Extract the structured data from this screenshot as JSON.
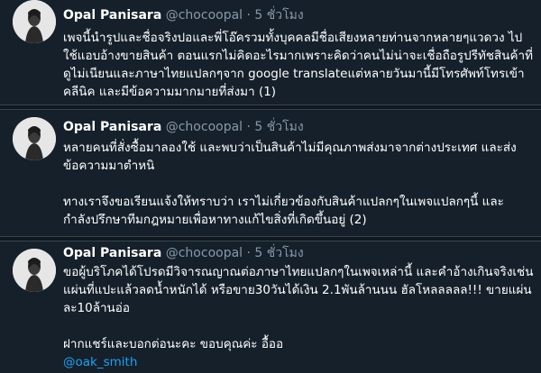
{
  "colors": {
    "background": "#15202b",
    "separator": "#10171e",
    "secondary_text": "#8899a6",
    "link": "#1da1f2"
  },
  "tweets": [
    {
      "name": "Opal Panisara",
      "handle": "@chocoopal",
      "separator": "·",
      "time": "5 ชั่วโมง",
      "lines": [
        "เพจนี้นำรูปและชื่อจริงปอและพี่โอ๊ครวมทั้งบุคคลมีชื่อเสียงหลายท่านจากหลายๆแวดวง ไป",
        "ใช้แอบอ้างขายสินค้า ตอนแรกไม่คิดอะไรมากเพราะคิดว่าคนไม่น่าจะเชื่อถือรูปรีทัชสินค้าที่",
        "ดูไม่เนียนและภาษาไทยแปลกๆจาก google translateแต่หลายวันมานี้มีโทรศัพท์โทรเข้า",
        "คลีนิค และมีข้อความมากมายที่ส่งมา (1)"
      ]
    },
    {
      "name": "Opal Panisara",
      "handle": "@chocoopal",
      "separator": "·",
      "time": "5 ชั่วโมง",
      "lines": [
        "หลายคนที่สั่งซื้อมาลองใช้ และพบว่าเป็นสินค้าไม่มีคุณภาพส่งมาจากต่างประเทศ และส่ง",
        "ข้อความมาตำหนิ",
        "",
        "ทางเราจึงขอเรียนแจ้งให้ทราบว่า เราไม่เกี่ยวข้องกับสินค้าแปลกๆในเพจแปลกๆนี้ และ",
        "กำลังปรึกษาทีมกฎหมายเพื่อหาทางแก้ไขสิ่งที่เกิดขึ้นอยู่ (2)"
      ]
    },
    {
      "name": "Opal Panisara",
      "handle": "@chocoopal",
      "separator": "·",
      "time": "5 ชั่วโมง",
      "lines": [
        "ขอผู้บริโภคได้โปรดมีวิจารณญาณต่อภาษาไทยแปลกๆในเพจเหล่านี้ และคำอ้างเกินจริงเช่น",
        "แผ่นที่แปะแล้วลดน้ำหนักได้ หรือขาย30วันได้เงิน 2.1พันล้านนน ฮัลโหลลลลล!!! ขายแผ่น",
        "ละ10ล้านอ่อ",
        "",
        "ฝากแชร์และบอกต่อนะคะ ขอบคุณค่ะ อื้ออ"
      ],
      "mention": "@oak_smith"
    }
  ]
}
